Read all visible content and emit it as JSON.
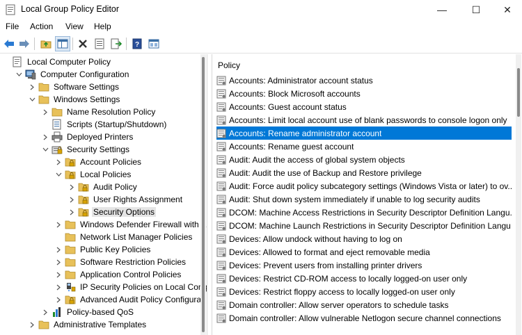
{
  "window": {
    "title": "Local Group Policy Editor",
    "min": "—",
    "max": "☐",
    "close": "✕"
  },
  "menu": [
    "File",
    "Action",
    "View",
    "Help"
  ],
  "toolbar": [
    "back-icon",
    "forward-icon",
    "up-folder-icon",
    "show-hide-tree-icon",
    "delete-icon",
    "properties-icon",
    "export-list-icon",
    "help-icon",
    "view-icon"
  ],
  "tree": [
    {
      "label": "Local Computer Policy",
      "depth": 0,
      "icon": "computer-policy",
      "exp": ""
    },
    {
      "label": "Computer Configuration",
      "depth": 1,
      "icon": "computer",
      "exp": "open"
    },
    {
      "label": "Software Settings",
      "depth": 2,
      "icon": "folder",
      "exp": "closed"
    },
    {
      "label": "Windows Settings",
      "depth": 2,
      "icon": "folder",
      "exp": "open"
    },
    {
      "label": "Name Resolution Policy",
      "depth": 3,
      "icon": "folder",
      "exp": "closed"
    },
    {
      "label": "Scripts (Startup/Shutdown)",
      "depth": 3,
      "icon": "script",
      "exp": ""
    },
    {
      "label": "Deployed Printers",
      "depth": 3,
      "icon": "printer",
      "exp": "closed"
    },
    {
      "label": "Security Settings",
      "depth": 3,
      "icon": "security",
      "exp": "open"
    },
    {
      "label": "Account Policies",
      "depth": 4,
      "icon": "lockfolder",
      "exp": "closed"
    },
    {
      "label": "Local Policies",
      "depth": 4,
      "icon": "lockfolder",
      "exp": "open"
    },
    {
      "label": "Audit Policy",
      "depth": 5,
      "icon": "lockfolder",
      "exp": "closed"
    },
    {
      "label": "User Rights Assignment",
      "depth": 5,
      "icon": "lockfolder",
      "exp": "closed"
    },
    {
      "label": "Security Options",
      "depth": 5,
      "icon": "lockfolder",
      "exp": "closed",
      "selected": true
    },
    {
      "label": "Windows Defender Firewall with A",
      "depth": 4,
      "icon": "folder",
      "exp": "closed"
    },
    {
      "label": "Network List Manager Policies",
      "depth": 4,
      "icon": "folder",
      "exp": ""
    },
    {
      "label": "Public Key Policies",
      "depth": 4,
      "icon": "folder",
      "exp": "closed"
    },
    {
      "label": "Software Restriction Policies",
      "depth": 4,
      "icon": "folder",
      "exp": "closed"
    },
    {
      "label": "Application Control Policies",
      "depth": 4,
      "icon": "folder",
      "exp": "closed"
    },
    {
      "label": "IP Security Policies on Local Comp",
      "depth": 4,
      "icon": "ipsec",
      "exp": "closed"
    },
    {
      "label": "Advanced Audit Policy Configurat",
      "depth": 4,
      "icon": "lockfolder",
      "exp": "closed"
    },
    {
      "label": "Policy-based QoS",
      "depth": 3,
      "icon": "chart",
      "exp": "closed"
    },
    {
      "label": "Administrative Templates",
      "depth": 2,
      "icon": "folder",
      "exp": "closed"
    }
  ],
  "list": {
    "column": "Policy",
    "items": [
      "Accounts: Administrator account status",
      "Accounts: Block Microsoft accounts",
      "Accounts: Guest account status",
      "Accounts: Limit local account use of blank passwords to console logon only",
      "Accounts: Rename administrator account",
      "Accounts: Rename guest account",
      "Audit: Audit the access of global system objects",
      "Audit: Audit the use of Backup and Restore privilege",
      "Audit: Force audit policy subcategory settings (Windows Vista or later) to ov...",
      "Audit: Shut down system immediately if unable to log security audits",
      "DCOM: Machine Access Restrictions in Security Descriptor Definition Langu...",
      "DCOM: Machine Launch Restrictions in Security Descriptor Definition Langu...",
      "Devices: Allow undock without having to log on",
      "Devices: Allowed to format and eject removable media",
      "Devices: Prevent users from installing printer drivers",
      "Devices: Restrict CD-ROM access to locally logged-on user only",
      "Devices: Restrict floppy access to locally logged-on user only",
      "Domain controller: Allow server operators to schedule tasks",
      "Domain controller: Allow vulnerable Netlogon secure channel connections"
    ],
    "selected_index": 4
  },
  "colors": {
    "selection": "#0078d7",
    "tree_selection": "#e5e5e5",
    "folder": "#e8c15a"
  }
}
